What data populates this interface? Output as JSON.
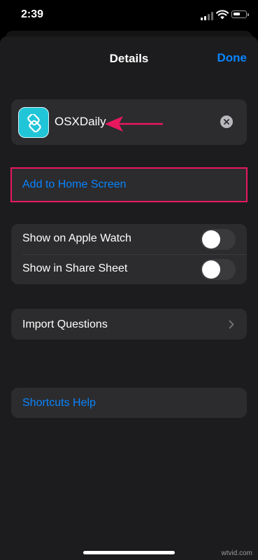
{
  "status_bar": {
    "time": "2:39"
  },
  "nav": {
    "title": "Details",
    "done_label": "Done"
  },
  "shortcut": {
    "name": "OSXDaily",
    "icon": "layers-icon",
    "icon_color": "#21c5d8"
  },
  "actions": {
    "add_to_home_screen": "Add to Home Screen"
  },
  "toggles": [
    {
      "label": "Show on Apple Watch",
      "on": false
    },
    {
      "label": "Show in Share Sheet",
      "on": false
    }
  ],
  "import_questions": {
    "label": "Import Questions"
  },
  "help": {
    "label": "Shortcuts Help"
  },
  "watermark": "wtvid.com",
  "colors": {
    "accent": "#0a84ff",
    "highlight": "#e8185e",
    "background": "#1c1c1e",
    "card": "#2c2c2e"
  }
}
